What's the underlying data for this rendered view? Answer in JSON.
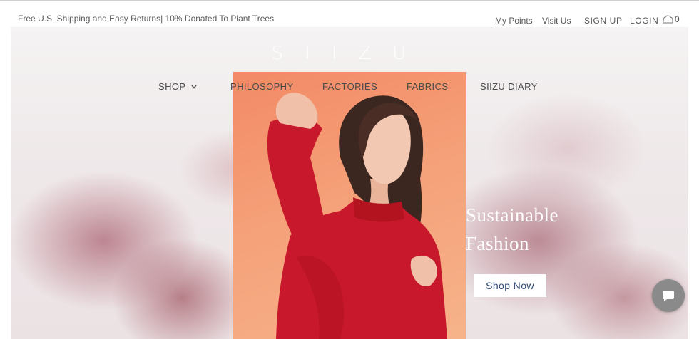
{
  "topbar": {
    "promo": "Free U.S. Shipping and Easy Returns| 10% Donated To Plant Trees",
    "my_points": "My Points",
    "visit_us": "Visit Us",
    "sign_up": "SIGN UP",
    "login": "LOGIN",
    "cart_count": "0",
    "cart_icon": "cart-icon"
  },
  "brand": {
    "logo": "SIIZU"
  },
  "nav": {
    "shop": "SHOP",
    "philosophy": "PHILOSOPHY",
    "factories": "FACTORIES",
    "fabrics": "FABRICS",
    "diary": "SIIZU DIARY"
  },
  "hero": {
    "headline_line1": "Sustainable",
    "headline_line2": "Fashion",
    "cta": "Shop Now"
  },
  "chat": {
    "icon": "chat-bubble-icon"
  },
  "colors": {
    "cta_text": "#2f4a73",
    "photo_bg": "#f5a078",
    "sweater": "#c8192c",
    "chat_bg": "#8a8a8a"
  }
}
